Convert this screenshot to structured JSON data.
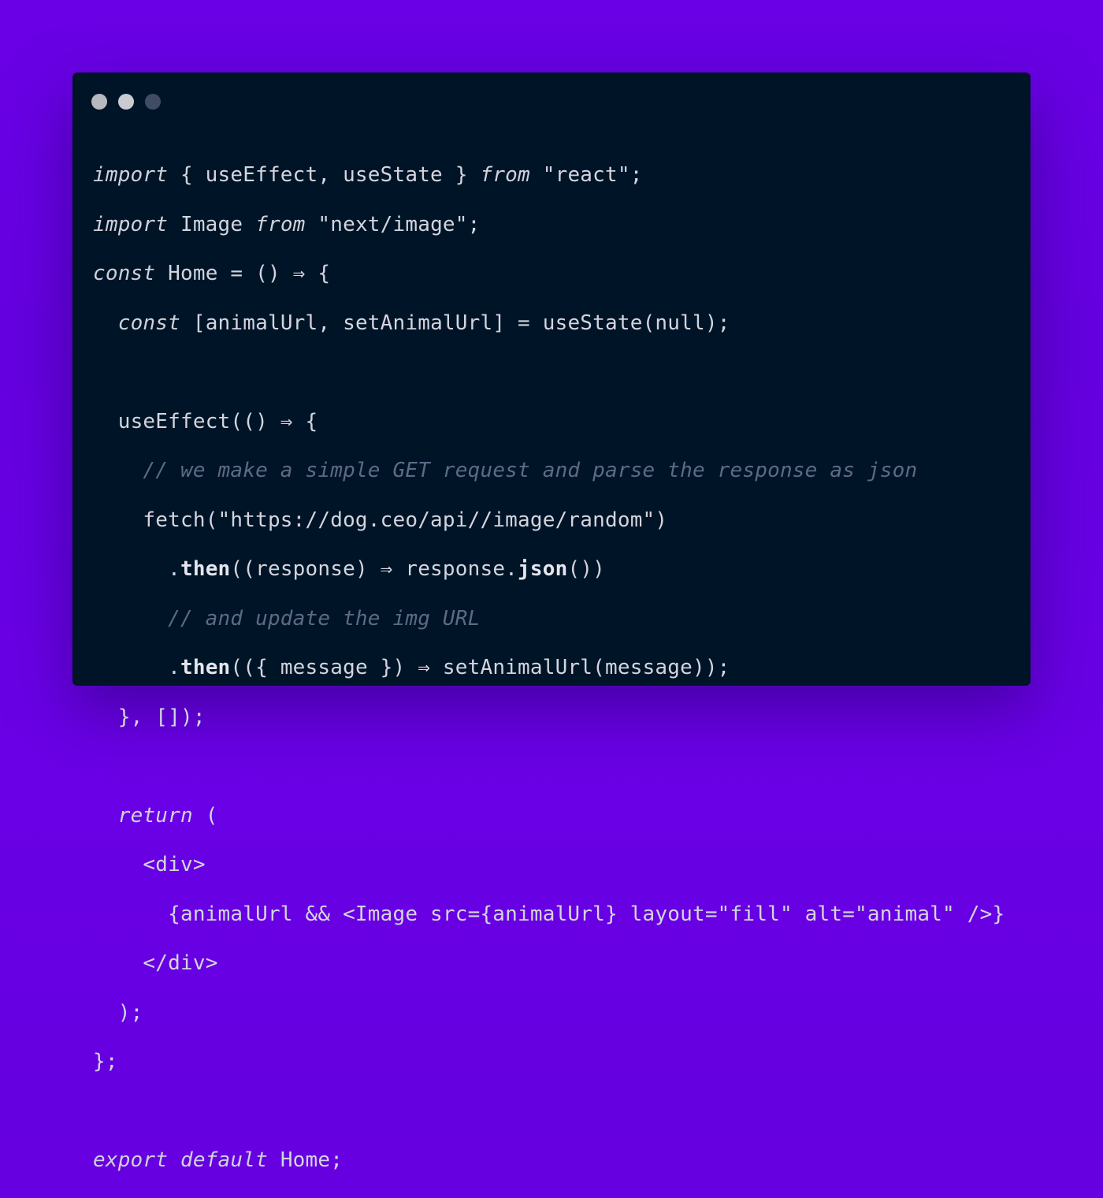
{
  "window": {
    "dots": [
      {
        "color": "#b8b9bf"
      },
      {
        "color": "#c9cbd3"
      },
      {
        "color": "#3f4c63"
      }
    ]
  },
  "colors": {
    "background": "#6a00e6",
    "panel": "#001427",
    "text": "#d3d5de",
    "comment": "#5d6a86"
  },
  "code": {
    "l1": {
      "a": "import",
      "b": " { useEffect, useState } ",
      "c": "from",
      "d": " \"react\";"
    },
    "l2": {
      "a": "import",
      "b": " Image ",
      "c": "from",
      "d": " \"next/image\";"
    },
    "l3": {
      "a": "const",
      "b": " Home = () ⇒ {"
    },
    "l4": {
      "a": "const",
      "b": " [animalUrl, setAnimalUrl] = useState(null);"
    },
    "l6": "useEffect(() ⇒ {",
    "l7": "// we make a simple GET request and parse the response as json",
    "l8": "fetch(\"https://dog.ceo/api//image/random\")",
    "l9": {
      "a": ".",
      "b": "then",
      "c": "((response) ⇒ response.",
      "d": "json",
      "e": "())"
    },
    "l10": "// and update the img URL",
    "l11": {
      "a": ".",
      "b": "then",
      "c": "(({ message }) ⇒ setAnimalUrl(message));"
    },
    "l12": "}, []);",
    "l14": {
      "a": "return",
      "b": " ("
    },
    "l15": "<div>",
    "l16": "{animalUrl && <Image src={animalUrl} layout=\"fill\" alt=\"animal\" />}",
    "l17": "</div>",
    "l18": ");",
    "l19": "};",
    "l21": {
      "a": "export",
      "b": " ",
      "c": "default",
      "d": " Home;"
    }
  }
}
